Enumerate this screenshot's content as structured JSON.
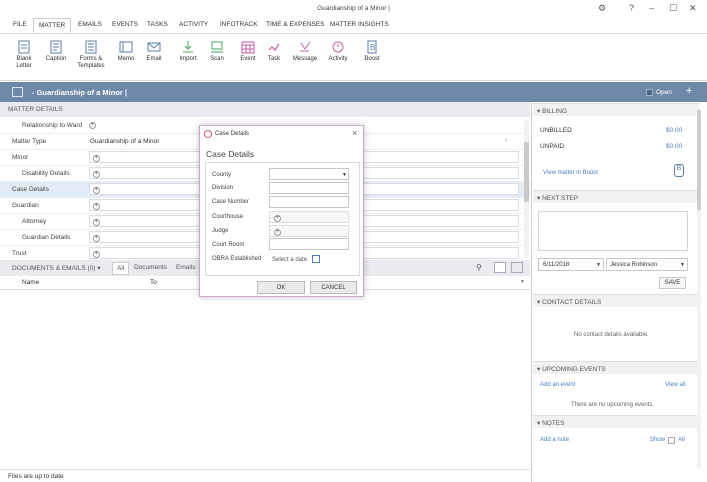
{
  "window": {
    "title": "Guardianship of a Minor |"
  },
  "tabs": [
    "FILE",
    "MATTER",
    "EMAILS",
    "EVENTS",
    "TASKS",
    "ACTIVITY",
    "INFOTRACK",
    "TIME & EXPENSES",
    "MATTER INSIGHTS"
  ],
  "ribbon": [
    {
      "label": "Blank\nLetter",
      "icon": "blank-letter-icon"
    },
    {
      "label": "Caption",
      "icon": "caption-icon"
    },
    {
      "label": "Forms &\nTemplates",
      "icon": "forms-templates-icon"
    },
    {
      "label": "Memo",
      "icon": "memo-icon"
    },
    {
      "label": "Email",
      "icon": "email-icon"
    },
    {
      "label": "Import",
      "icon": "import-icon"
    },
    {
      "label": "Scan",
      "icon": "scan-icon"
    },
    {
      "label": "Event",
      "icon": "event-icon"
    },
    {
      "label": "Task",
      "icon": "task-icon"
    },
    {
      "label": "Message",
      "icon": "message-icon"
    },
    {
      "label": "Activity",
      "icon": "activity-icon"
    },
    {
      "label": "Boost",
      "icon": "boost-icon"
    }
  ],
  "matter": {
    "title": "- Guardianship of a Minor |",
    "status": "Open"
  },
  "details": {
    "header": "MATTER DETAILS",
    "rows": [
      {
        "label": "Relationship to Ward",
        "value": "",
        "indent": true
      },
      {
        "label": "Matter Type",
        "value": "Guardianship of a Minor",
        "indent": false
      },
      {
        "label": "Minor",
        "value": "",
        "indent": false
      },
      {
        "label": "Disability Details",
        "value": "",
        "indent": true
      },
      {
        "label": "Case Details",
        "value": "",
        "indent": false
      },
      {
        "label": "Guardian",
        "value": "",
        "indent": false
      },
      {
        "label": "Attorney",
        "value": "",
        "indent": true
      },
      {
        "label": "Guardian Details",
        "value": "",
        "indent": true
      },
      {
        "label": "Trust",
        "value": "",
        "indent": false
      }
    ]
  },
  "documents": {
    "header": "DOCUMENTS & EMAILS (0) ▾",
    "filters": [
      "All",
      "Documents",
      "Emails"
    ],
    "columns": [
      "Name",
      "To"
    ]
  },
  "status_bar": "Files are up to date",
  "billing": {
    "header": "BILLING",
    "unbilled_label": "UNBILLED",
    "unbilled": "$0.00",
    "unpaid_label": "UNPAID",
    "unpaid": "$0.00",
    "link": "View matter in Boost"
  },
  "next_step": {
    "header": "NEXT STEP",
    "date": "6/11/2018",
    "assignee": "Jessica Robinson",
    "save": "SAVE"
  },
  "contact": {
    "header": "CONTACT DETAILS",
    "empty": "No contact details available."
  },
  "events": {
    "header": "UPCOMING EVENTS",
    "add": "Add an event",
    "view_all": "View all",
    "empty": "There are no upcoming events."
  },
  "notes": {
    "header": "NOTES",
    "add": "Add a note",
    "show": "Show",
    "all": "All"
  },
  "dialog": {
    "title": "Case Details",
    "heading": "Case Details",
    "fields": [
      "County",
      "Division",
      "Case Number",
      "Courthouse",
      "Judge",
      "Court Room",
      "OBRA Established"
    ],
    "date_placeholder": "Select a date",
    "ok": "OK",
    "cancel": "CANCEL"
  }
}
